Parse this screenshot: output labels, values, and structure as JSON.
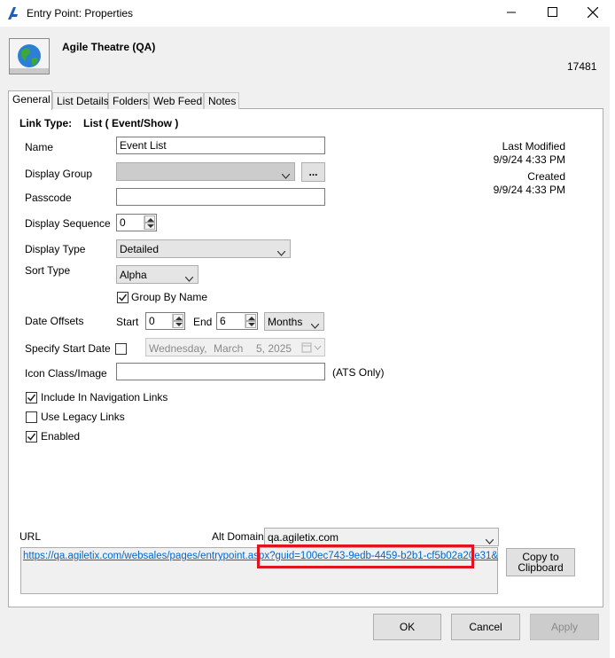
{
  "window": {
    "title": "Entry Point: Properties",
    "minimize_icon": "minimize-icon",
    "maximize_icon": "maximize-icon",
    "close_icon": "close-icon"
  },
  "header": {
    "name": "Agile Theatre (QA)",
    "id": "17481",
    "icon": "globe-icon"
  },
  "tabs": [
    {
      "label": "General",
      "active": true
    },
    {
      "label": "List Details"
    },
    {
      "label": "Folders"
    },
    {
      "label": "Web Feed"
    },
    {
      "label": "Notes"
    }
  ],
  "general": {
    "link_type_label": "Link Type:",
    "link_type_value": "List ( Event/Show )",
    "name_label": "Name",
    "name_value": "Event List",
    "display_group_label": "Display Group",
    "display_group_value": "",
    "ellipsis_label": "...",
    "passcode_label": "Passcode",
    "passcode_value": "",
    "display_sequence_label": "Display Sequence",
    "display_sequence_value": "0",
    "display_type_label": "Display Type",
    "display_type_value": "Detailed",
    "sort_type_label": "Sort Type",
    "sort_type_value": "Alpha",
    "group_by_name_label": "Group By Name",
    "group_by_name_checked": true,
    "date_offsets_label": "Date Offsets",
    "start_label": "Start",
    "start_value": "0",
    "end_label": "End",
    "end_value": "6",
    "offset_unit_value": "Months",
    "specify_start_date_label": "Specify Start Date",
    "specify_start_date_checked": false,
    "start_date_weekday": "Wednesday,",
    "start_date_month": "March",
    "start_date_day_year": "5, 2025",
    "icon_class_label": "Icon Class/Image",
    "icon_class_value": "",
    "ats_only_label": "(ATS Only)",
    "include_nav_label": "Include In Navigation Links",
    "include_nav_checked": true,
    "legacy_links_label": "Use Legacy Links",
    "legacy_links_checked": false,
    "enabled_label": "Enabled",
    "enabled_checked": true,
    "last_modified_label": "Last Modified",
    "last_modified_value": "9/9/24 4:33 PM",
    "created_label": "Created",
    "created_value": "9/9/24 4:33 PM",
    "url_label": "URL",
    "alt_domain_label": "Alt Domain",
    "alt_domain_value": "qa.agiletix.com",
    "url_value": "https://qa.agiletix.com/websales/pages/entrypoint.aspx?guid=100ec743-9edb-4459-b2b1-cf5b02a20e31&",
    "copy_button_label": "Copy to Clipboard"
  },
  "footer": {
    "ok_label": "OK",
    "cancel_label": "Cancel",
    "apply_label": "Apply"
  },
  "colors": {
    "link": "#0066cc",
    "highlight": "#e0141e",
    "app_icon": "#1e5fb4"
  }
}
